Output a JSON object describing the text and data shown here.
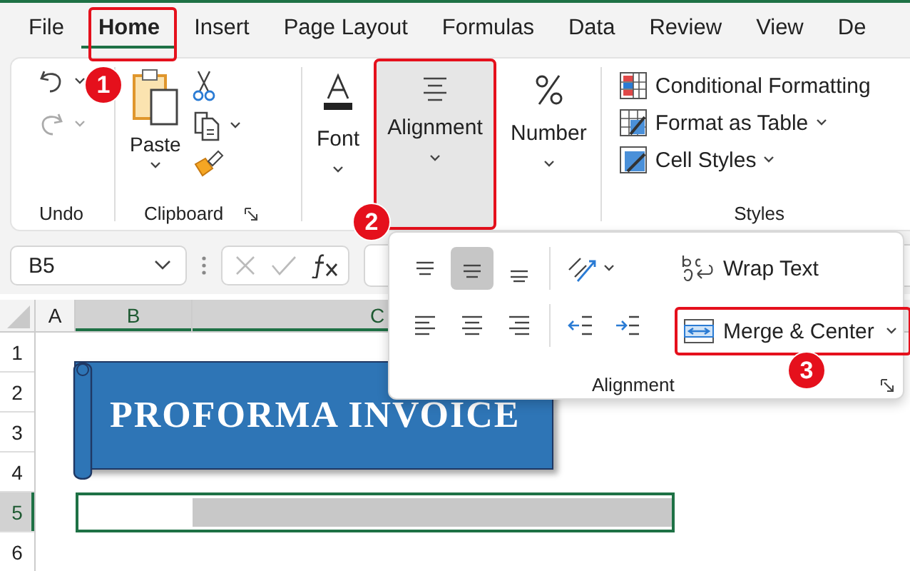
{
  "tabs": [
    {
      "label": "File",
      "selected": false
    },
    {
      "label": "Home",
      "selected": true
    },
    {
      "label": "Insert",
      "selected": false
    },
    {
      "label": "Page Layout",
      "selected": false
    },
    {
      "label": "Formulas",
      "selected": false
    },
    {
      "label": "Data",
      "selected": false
    },
    {
      "label": "Review",
      "selected": false
    },
    {
      "label": "View",
      "selected": false
    },
    {
      "label": "De",
      "selected": false
    }
  ],
  "ribbon": {
    "undo_group": "Undo",
    "paste": "Paste",
    "clipboard_group": "Clipboard",
    "font": "Font",
    "alignment": {
      "label": "Alignment",
      "selected": true
    },
    "number": "Number",
    "styles": [
      {
        "kind": "conditional",
        "label": "Conditional Formatting"
      },
      {
        "kind": "table",
        "label": "Format as Table"
      },
      {
        "kind": "cell",
        "label": "Cell Styles"
      }
    ],
    "styles_group": "Styles"
  },
  "formula_bar": {
    "name_box": "B5"
  },
  "sheet": {
    "columns": [
      {
        "label": "A",
        "selected": false
      },
      {
        "label": "B",
        "selected": true
      },
      {
        "label": "C",
        "selected": true
      }
    ],
    "rows": [
      {
        "label": "1",
        "selected": false
      },
      {
        "label": "2",
        "selected": false
      },
      {
        "label": "3",
        "selected": false
      },
      {
        "label": "4",
        "selected": false
      },
      {
        "label": "5",
        "selected": true
      },
      {
        "label": "6",
        "selected": false
      }
    ],
    "banner": "PROFORMA INVOICE"
  },
  "alignment_popup": {
    "top_row": [
      {
        "kind": "top",
        "selected": false
      },
      {
        "kind": "middle",
        "selected": true
      },
      {
        "kind": "bottom",
        "selected": false
      },
      {
        "kind": "orientation",
        "selected": false
      }
    ],
    "bottom_row": [
      {
        "kind": "left",
        "selected": false
      },
      {
        "kind": "center",
        "selected": false
      },
      {
        "kind": "right",
        "selected": false
      },
      {
        "kind": "outdent",
        "selected": false
      },
      {
        "kind": "indent",
        "selected": false
      }
    ],
    "wrap_text": "Wrap Text",
    "merge_center": "Merge & Center",
    "group_label": "Alignment"
  },
  "callouts": [
    "1",
    "2",
    "3"
  ]
}
